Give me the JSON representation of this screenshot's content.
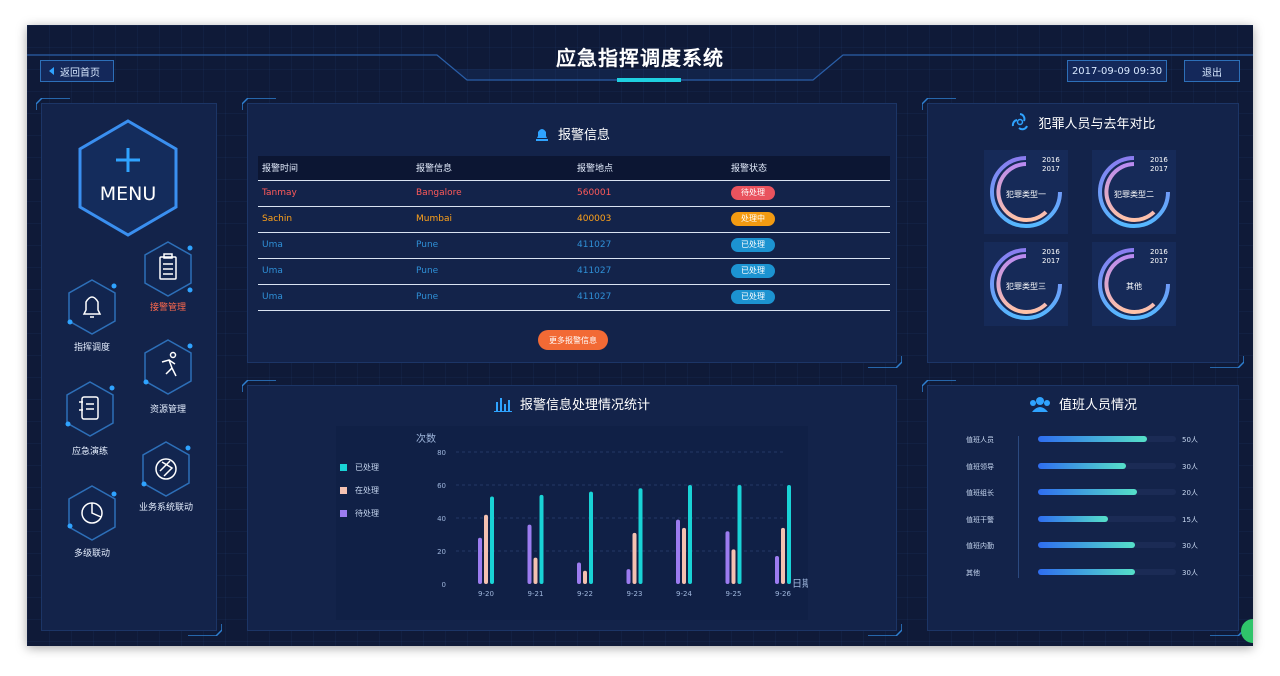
{
  "header": {
    "title": "应急指挥调度系统",
    "back_label": "返回首页",
    "datetime": "2017-09-09 09:30",
    "exit_label": "退出"
  },
  "menu": {
    "logo_text": "MENU",
    "items": [
      {
        "label": "接警管理",
        "icon": "clipboard-icon",
        "active": true
      },
      {
        "label": "指挥调度",
        "icon": "bell-icon",
        "active": false
      },
      {
        "label": "资源管理",
        "icon": "runner-icon",
        "active": false
      },
      {
        "label": "应急演练",
        "icon": "notebook-icon",
        "active": false
      },
      {
        "label": "业务系统联动",
        "icon": "aperture-icon",
        "active": false
      },
      {
        "label": "多级联动",
        "icon": "pie-icon",
        "active": false
      }
    ]
  },
  "alarm_panel": {
    "title": "报警信息",
    "columns": [
      "报警时间",
      "报警信息",
      "报警地点",
      "报警状态"
    ],
    "rows": [
      {
        "time": "Tanmay",
        "info": "Bangalore",
        "place": "560001",
        "status": "待处理"
      },
      {
        "time": "Sachin",
        "info": "Mumbai",
        "place": "400003",
        "status": "处理中"
      },
      {
        "time": "Uma",
        "info": "Pune",
        "place": "411027",
        "status": "已处理"
      },
      {
        "time": "Uma",
        "info": "Pune",
        "place": "411027",
        "status": "已处理"
      },
      {
        "time": "Uma",
        "info": "Pune",
        "place": "411027",
        "status": "已处理"
      }
    ],
    "status_colors": {
      "待处理": "#e9535e",
      "处理中": "#f39b12",
      "已处理": "#1c93d1"
    },
    "more_label": "更多报警信息"
  },
  "crime_panel": {
    "title": "犯罪人员与去年对比",
    "items": [
      {
        "label": "犯罪类型一",
        "year_a": "2016",
        "year_b": "2017"
      },
      {
        "label": "犯罪类型二",
        "year_a": "2016",
        "year_b": "2017"
      },
      {
        "label": "犯罪类型三",
        "year_a": "2016",
        "year_b": "2017"
      },
      {
        "label": "其他",
        "year_a": "2016",
        "year_b": "2017"
      }
    ]
  },
  "stats_panel": {
    "title": "报警信息处理情况统计"
  },
  "chart_data": {
    "type": "bar",
    "ylabel": "次数",
    "xlabel": "日期",
    "ylim": [
      0,
      80
    ],
    "yticks": [
      0,
      20,
      40,
      60,
      80
    ],
    "categories": [
      "9-20",
      "9-21",
      "9-22",
      "9-23",
      "9-24",
      "9-25",
      "9-26"
    ],
    "series": [
      {
        "name": "已处理",
        "color": "#19d3d6",
        "values": [
          53,
          54,
          56,
          58,
          60,
          60,
          60
        ]
      },
      {
        "name": "在处理",
        "color": "#f4c1b1",
        "values": [
          42,
          16,
          8,
          31,
          34,
          21,
          34
        ]
      },
      {
        "name": "待处理",
        "color": "#9c7cf0",
        "values": [
          28,
          36,
          13,
          9,
          39,
          32,
          17
        ]
      }
    ],
    "legend_position": "left",
    "grid": true
  },
  "duty_panel": {
    "title": "值班人员情况",
    "rows": [
      {
        "label": "值班人员",
        "value": "50人",
        "ratio": 0.79
      },
      {
        "label": "值班领导",
        "value": "30人",
        "ratio": 0.64
      },
      {
        "label": "值班组长",
        "value": "20人",
        "ratio": 0.72
      },
      {
        "label": "值班干警",
        "value": "15人",
        "ratio": 0.51
      },
      {
        "label": "值班内勤",
        "value": "30人",
        "ratio": 0.7
      },
      {
        "label": "其他",
        "value": "30人",
        "ratio": 0.7
      }
    ]
  }
}
